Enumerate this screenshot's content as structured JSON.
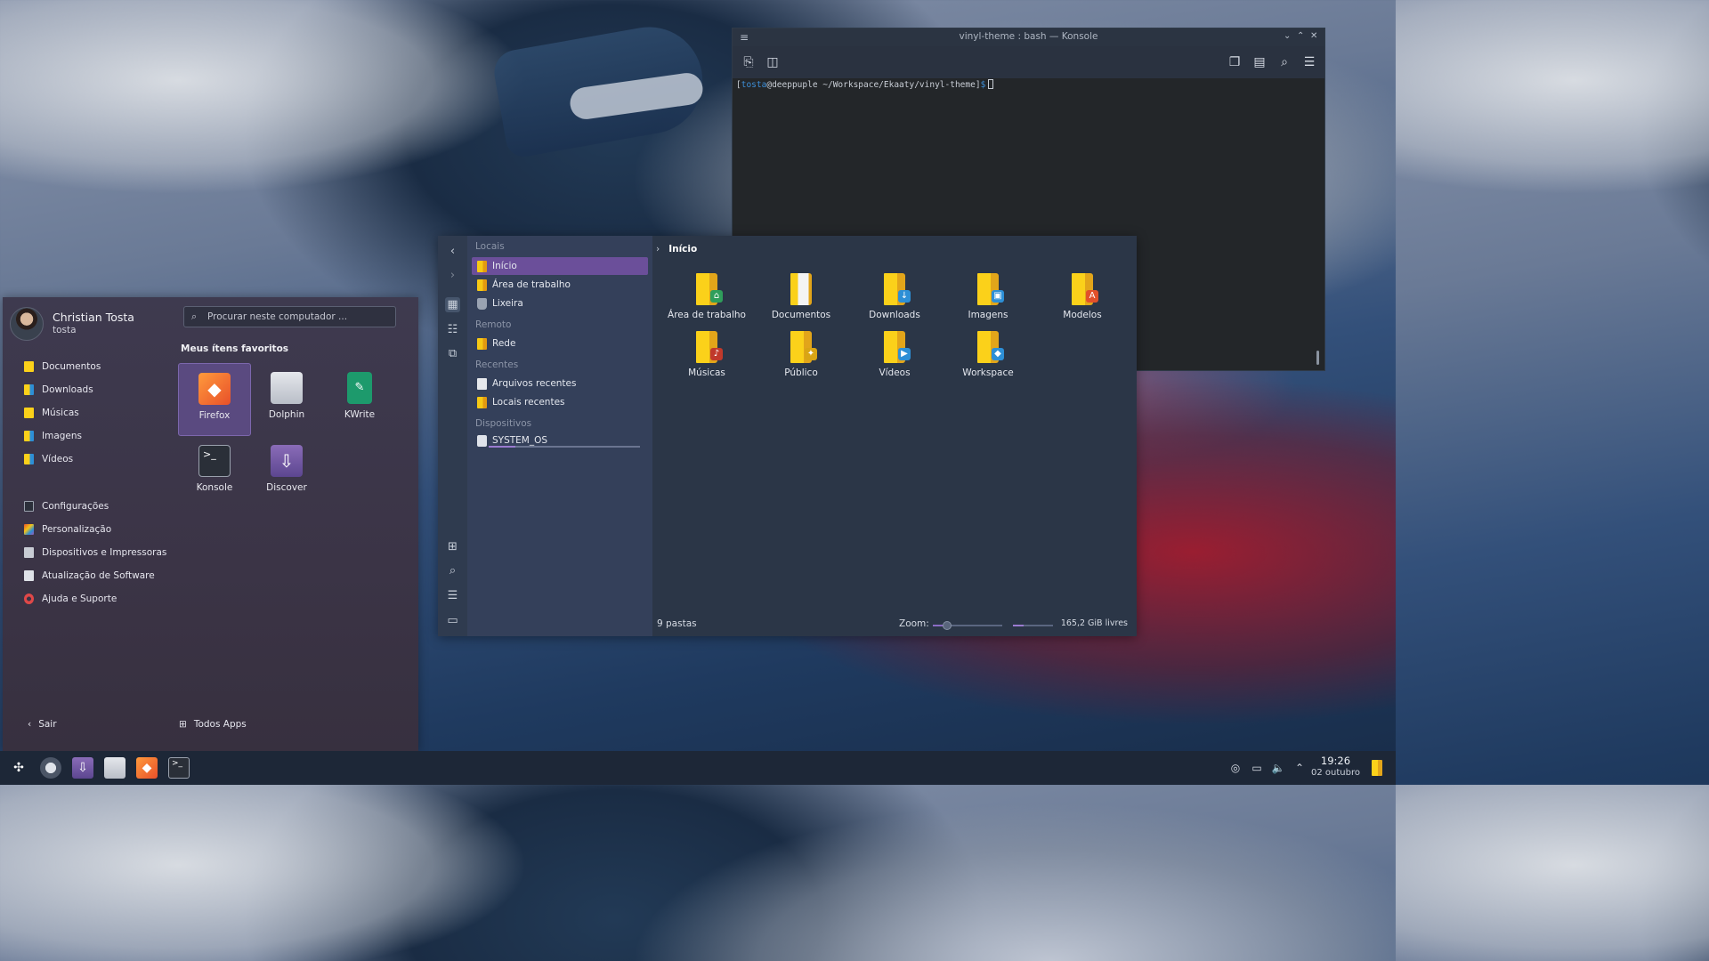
{
  "konsole": {
    "title": "vinyl-theme : bash — Konsole",
    "prompt_open": "[",
    "prompt_user": "tosta",
    "prompt_host": "@deeppuple ~/Workspace/Ekaaty/vinyl-theme]",
    "prompt_symbol": "$"
  },
  "dolphin": {
    "sidebar": {
      "places_header": "Locais",
      "places": [
        {
          "label": "Início",
          "icon": "home-folder-icon",
          "selected": true
        },
        {
          "label": "Área de trabalho",
          "icon": "desktop-folder-icon"
        },
        {
          "label": "Lixeira",
          "icon": "trash-icon"
        }
      ],
      "remote_header": "Remoto",
      "remote": [
        {
          "label": "Rede",
          "icon": "network-folder-icon"
        }
      ],
      "recent_header": "Recentes",
      "recent": [
        {
          "label": "Arquivos recentes",
          "icon": "recent-files-icon"
        },
        {
          "label": "Locais recentes",
          "icon": "recent-places-icon"
        }
      ],
      "devices_header": "Dispositivos",
      "devices": [
        {
          "label": "SYSTEM_OS",
          "icon": "drive-icon",
          "used_fraction": 0.18
        }
      ]
    },
    "breadcrumb": "Início",
    "folders": [
      {
        "label": "Área de trabalho",
        "icon": "desktop-folder-icon",
        "emblem_color": "#2f9e5b"
      },
      {
        "label": "Documentos",
        "icon": "documents-folder-icon",
        "emblem_color": "#f2f2f2"
      },
      {
        "label": "Downloads",
        "icon": "downloads-folder-icon",
        "emblem_color": "#2d8fd6"
      },
      {
        "label": "Imagens",
        "icon": "pictures-folder-icon",
        "emblem_color": "#2d8fd6"
      },
      {
        "label": "Modelos",
        "icon": "templates-folder-icon",
        "emblem_color": "#e2502a"
      },
      {
        "label": "Músicas",
        "icon": "music-folder-icon",
        "emblem_color": "#c0392b"
      },
      {
        "label": "Público",
        "icon": "public-folder-icon",
        "emblem_color": "#d9a514"
      },
      {
        "label": "Vídeos",
        "icon": "videos-folder-icon",
        "emblem_color": "#2d8fd6"
      },
      {
        "label": "Workspace",
        "icon": "workspace-folder-icon",
        "emblem_color": "#2d8fd6"
      }
    ],
    "status": {
      "count": "9 pastas",
      "zoom_label": "Zoom:",
      "zoom_fraction": 0.2,
      "free_space": "165,2 GiB livres",
      "used_fraction": 0.25
    }
  },
  "launcher": {
    "user_name": "Christian Tosta",
    "user_login": "tosta",
    "search_placeholder": "Procurar neste computador ...",
    "favorites_header": "Meus ítens favoritos",
    "favorites": [
      {
        "label": "Firefox",
        "icon": "firefox-icon",
        "selected": true
      },
      {
        "label": "Dolphin",
        "icon": "dolphin-icon"
      },
      {
        "label": "KWrite",
        "icon": "kwrite-icon"
      },
      {
        "label": "Konsole",
        "icon": "konsole-icon"
      },
      {
        "label": "Discover",
        "icon": "discover-icon"
      }
    ],
    "places": [
      {
        "label": "Documentos",
        "icon": "documents-folder-icon"
      },
      {
        "label": "Downloads",
        "icon": "downloads-folder-icon"
      },
      {
        "label": "Músicas",
        "icon": "music-folder-icon"
      },
      {
        "label": "Imagens",
        "icon": "pictures-folder-icon"
      },
      {
        "label": "Vídeos",
        "icon": "videos-folder-icon"
      }
    ],
    "system": [
      {
        "label": "Configurações",
        "icon": "settings-icon"
      },
      {
        "label": "Personalização",
        "icon": "personalization-icon"
      },
      {
        "label": "Dispositivos e Impressoras",
        "icon": "printer-icon"
      },
      {
        "label": "Atualização de Software",
        "icon": "software-update-icon"
      },
      {
        "label": "Ajuda e Suporte",
        "icon": "help-icon"
      }
    ],
    "leave_label": "Sair",
    "all_apps_label": "Todos Apps"
  },
  "taskbar": {
    "apps": [
      "app-launcher-icon",
      "system-settings-icon",
      "discover-icon",
      "dolphin-icon",
      "firefox-icon",
      "konsole-icon"
    ],
    "time": "19:26",
    "date": "02 outubro"
  },
  "colors": {
    "accent": "#6b4f9a",
    "folder_yellow": "#fbd11a",
    "panel": "#1d2737"
  }
}
